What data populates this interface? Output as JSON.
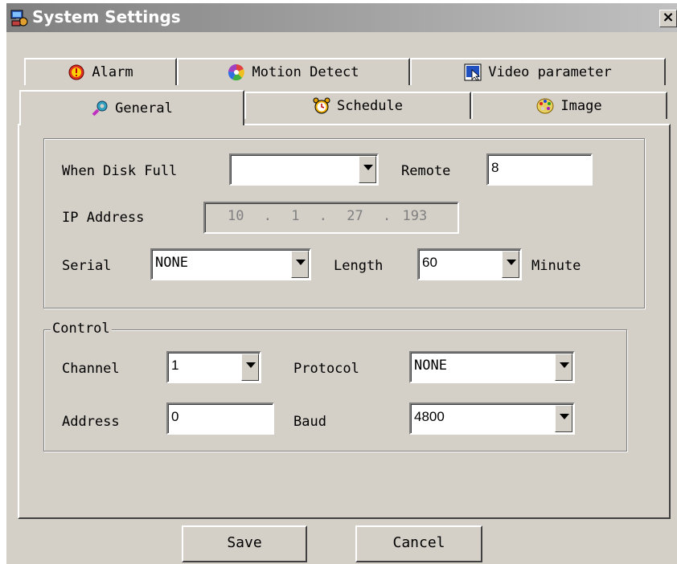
{
  "window": {
    "title": "System Settings",
    "close_label": "×"
  },
  "tabs_back": [
    {
      "label": "Alarm",
      "icon": "alarm-icon"
    },
    {
      "label": "Motion Detect",
      "icon": "motion-detect-icon"
    },
    {
      "label": "Video parameter",
      "icon": "video-parameter-icon"
    }
  ],
  "tabs_front": [
    {
      "label": "General",
      "icon": "general-icon",
      "active": true
    },
    {
      "label": "Schedule",
      "icon": "schedule-icon"
    },
    {
      "label": "Image",
      "icon": "image-icon"
    }
  ],
  "general": {
    "when_disk_full_label": "When Disk Full",
    "when_disk_full_value": "",
    "remote_label": "Remote",
    "remote_value": "8",
    "ip_label": "IP Address",
    "ip": [
      "10",
      "1",
      "27",
      "193"
    ],
    "ip_sep": ".",
    "serial_label": "Serial",
    "serial_value": "NONE",
    "length_label": "Length",
    "length_value": "60",
    "minute_label": "Minute"
  },
  "control": {
    "legend": "Control",
    "channel_label": "Channel",
    "channel_value": "1",
    "protocol_label": "Protocol",
    "protocol_value": "NONE",
    "address_label": "Address",
    "address_value": "0",
    "baud_label": "Baud",
    "baud_value": "4800"
  },
  "buttons": {
    "save": "Save",
    "cancel": "Cancel"
  }
}
